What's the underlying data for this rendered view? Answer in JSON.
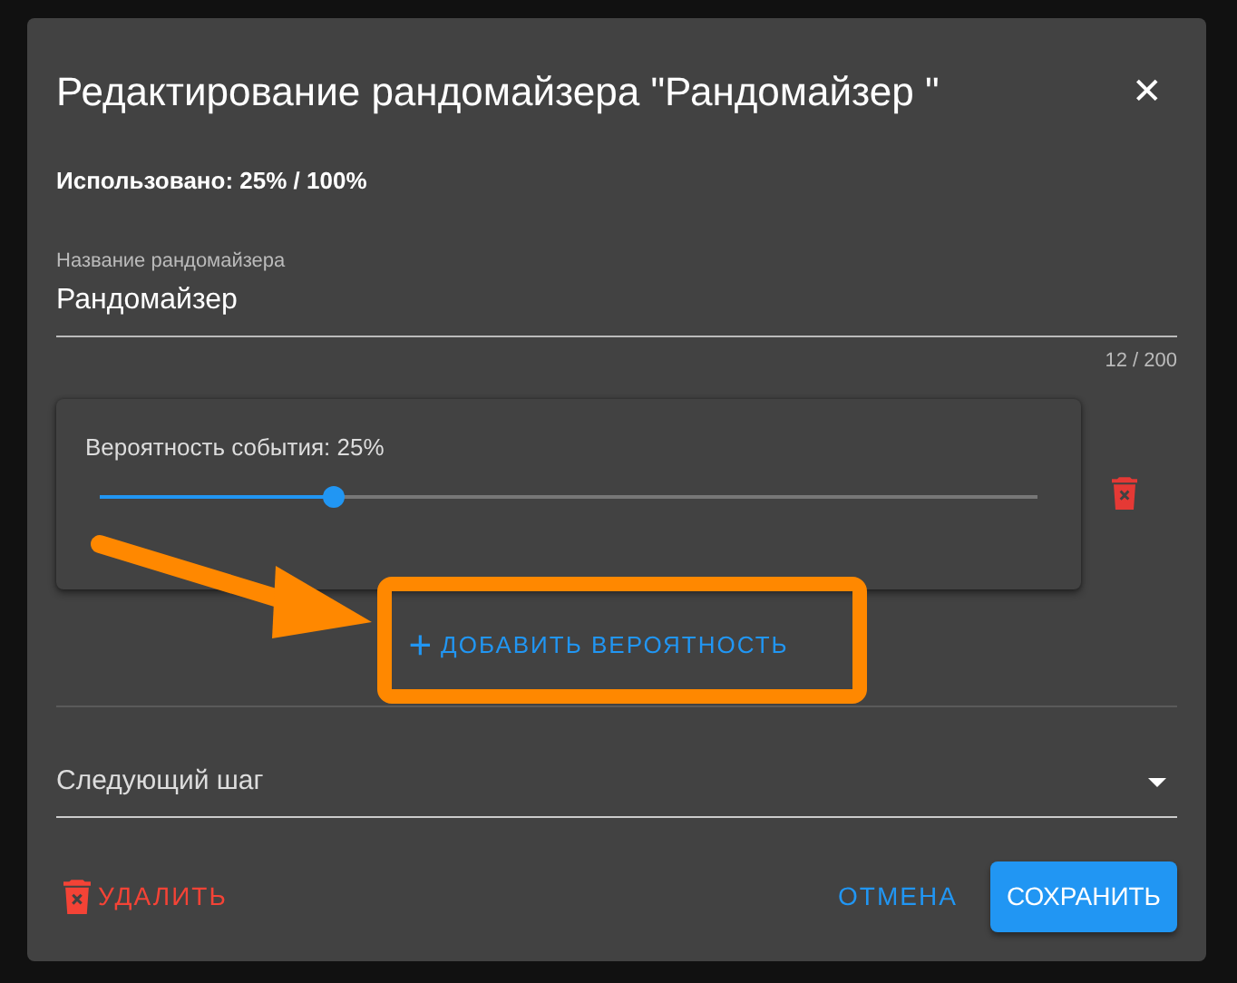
{
  "dialog": {
    "title": "Редактирование рандомайзера \"Рандомайзер \"",
    "close_icon": "✕",
    "usage": "Использовано: 25% / 100%",
    "name_field": {
      "label": "Название рандомайзера",
      "value": "Рандомайзер",
      "counter": "12 / 200"
    },
    "probabilities": [
      {
        "label": "Вероятность события: 25%",
        "level": 0.25
      }
    ],
    "add_button": {
      "icon": "+",
      "label": "ДОБАВИТЬ ВЕРОЯТНОСТЬ"
    },
    "next_step": {
      "placeholder": "Следующий шаг"
    },
    "footer": {
      "delete": "УДАЛИТЬ",
      "cancel": "ОТМЕНА",
      "save": "СОХРАНИТЬ"
    }
  }
}
